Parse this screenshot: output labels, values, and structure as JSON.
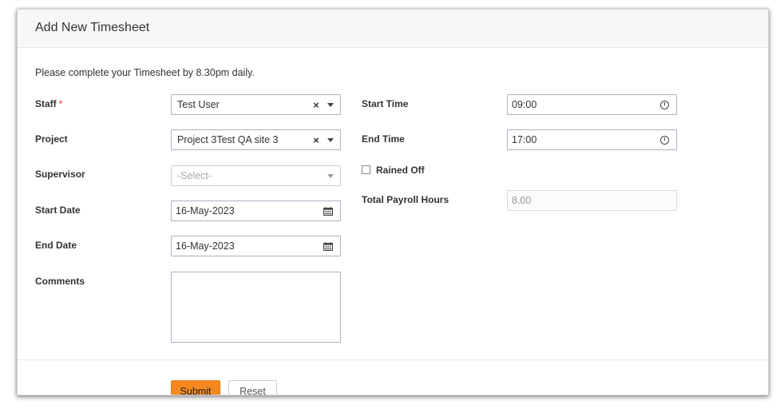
{
  "form": {
    "title": "Add New Timesheet",
    "note": "Please complete your Timesheet by 8.30pm daily.",
    "staff": {
      "label": "Staff",
      "required_mark": "*",
      "value": "Test User"
    },
    "project": {
      "label": "Project",
      "value": "Project 3Test QA site 3"
    },
    "supervisor": {
      "label": "Supervisor",
      "placeholder": "-Select-"
    },
    "start_date": {
      "label": "Start Date",
      "value": "16-May-2023"
    },
    "end_date": {
      "label": "End Date",
      "value": "16-May-2023"
    },
    "comments": {
      "label": "Comments",
      "value": ""
    },
    "start_time": {
      "label": "Start Time",
      "value": "09:00"
    },
    "end_time": {
      "label": "End Time",
      "value": "17:00"
    },
    "rained_off": {
      "label": "Rained Off",
      "checked": false
    },
    "total_payroll_hours": {
      "label": "Total Payroll Hours",
      "value": "8.00"
    },
    "buttons": {
      "submit": "Submit",
      "reset": "Reset"
    }
  },
  "icons": {
    "clear": "close-icon",
    "dropdown": "chevron-down-icon",
    "calendar": "calendar-icon",
    "time": "clock-icon"
  },
  "colors": {
    "accent": "#f5891f",
    "required": "#e0251b"
  }
}
